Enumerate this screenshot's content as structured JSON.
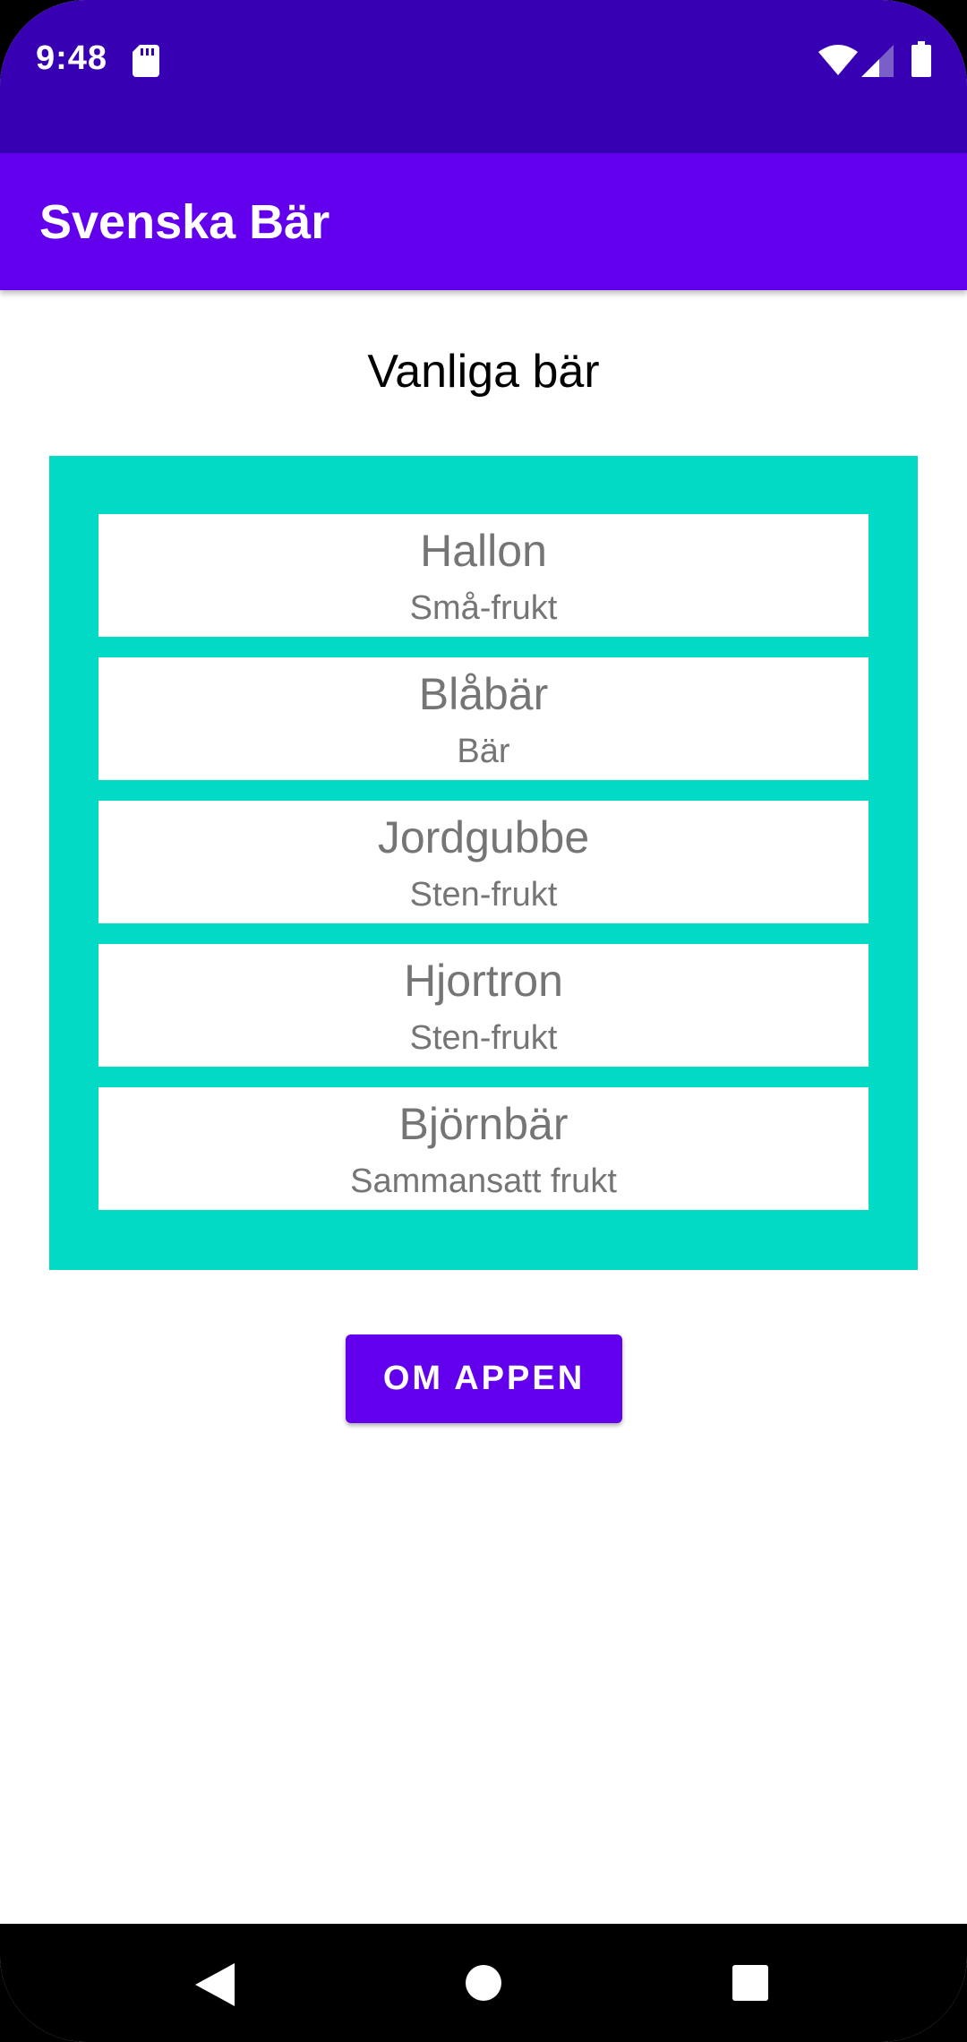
{
  "status_bar": {
    "time": "9:48",
    "icons": [
      "sd-card-icon",
      "wifi-icon",
      "cell-signal-icon",
      "battery-icon"
    ],
    "background": "#3700B3"
  },
  "app_bar": {
    "title": "Svenska Bär",
    "background": "#6200EE"
  },
  "main": {
    "section_title": "Vanliga bär",
    "list_background": "#03DAC5",
    "berries": [
      {
        "name": "Hallon",
        "type": "Små-frukt"
      },
      {
        "name": "Blåbär",
        "type": "Bär"
      },
      {
        "name": "Jordgubbe",
        "type": "Sten-frukt"
      },
      {
        "name": "Hjortron",
        "type": "Sten-frukt"
      },
      {
        "name": "Björnbär",
        "type": "Sammansatt frukt"
      }
    ],
    "about_button_label": "OM APPEN"
  },
  "nav_bar": {
    "icons": [
      "back-icon",
      "home-icon",
      "recents-icon"
    ]
  }
}
